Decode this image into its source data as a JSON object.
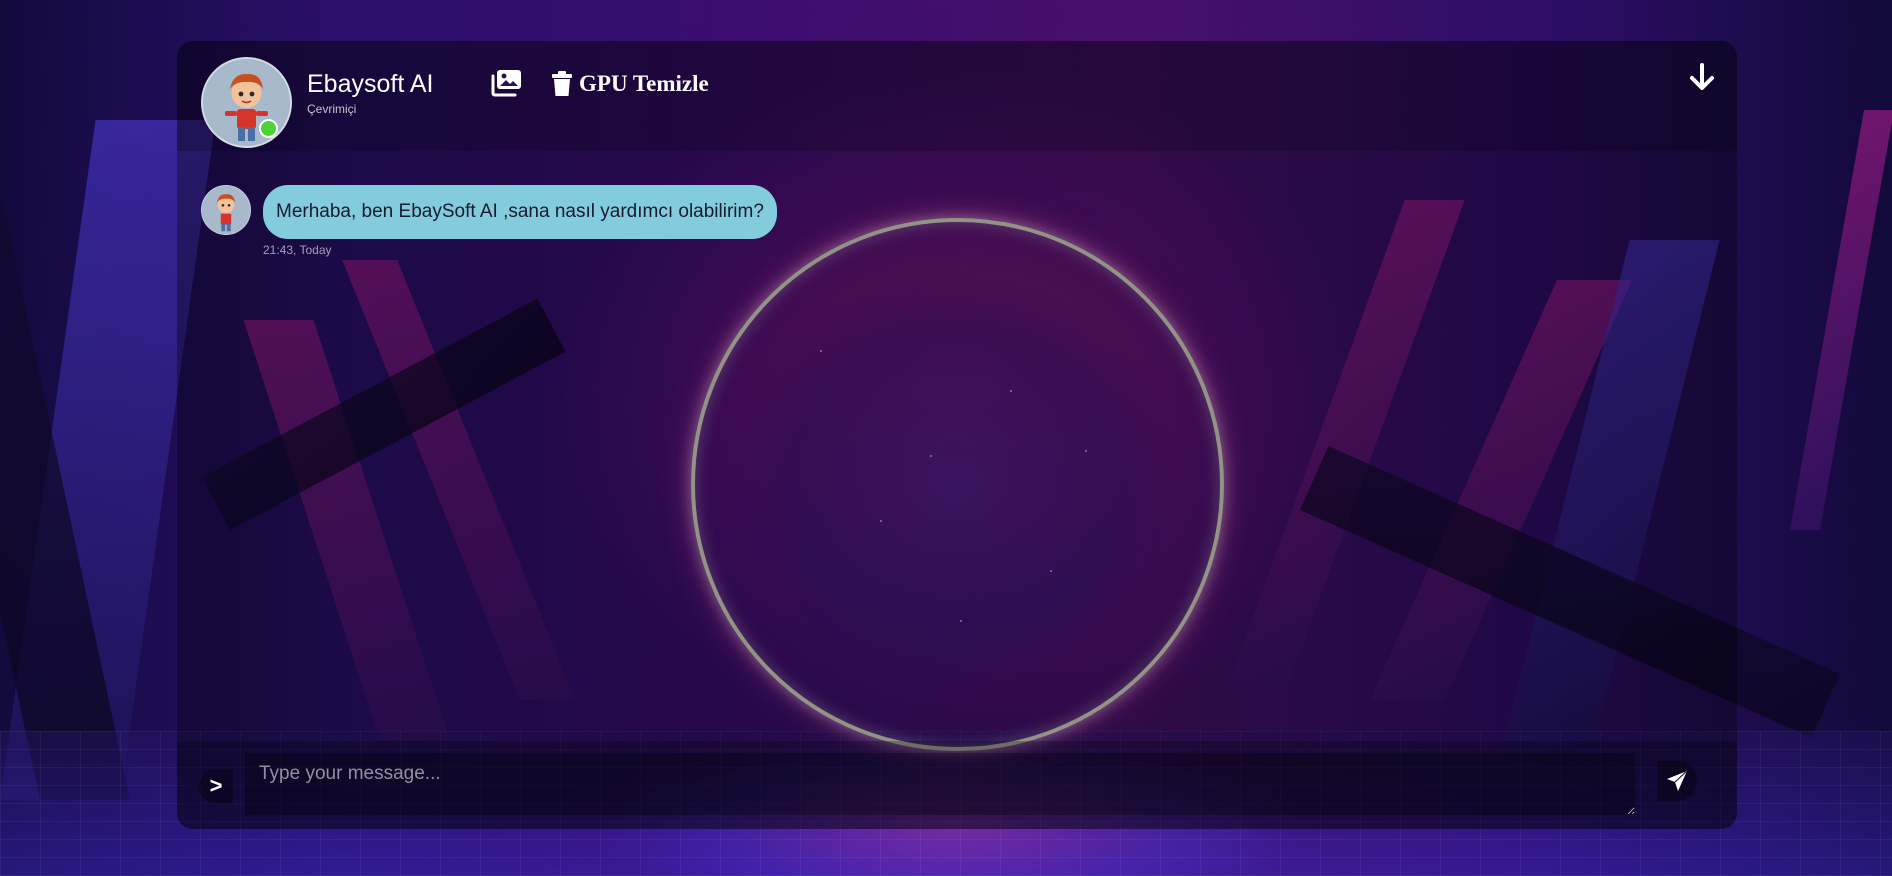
{
  "header": {
    "bot_name": "Ebaysoft AI",
    "status": "Çevrimiçi",
    "gallery_icon": "images-icon",
    "clear_gpu_label": "GPU Temizle",
    "clear_gpu_icon": "trash-icon",
    "scroll_down_icon": "arrow-down-icon",
    "online_color": "#4cd137"
  },
  "messages": [
    {
      "sender": "bot",
      "text": "Merhaba, ben EbaySoft AI ,sana nasıl yardımcı olabilirim?",
      "time": "21:43, Today",
      "bubble_color": "#82ccdd"
    }
  ],
  "composer": {
    "attach_label": ">",
    "placeholder": "Type your message...",
    "send_icon": "paper-plane-icon"
  }
}
